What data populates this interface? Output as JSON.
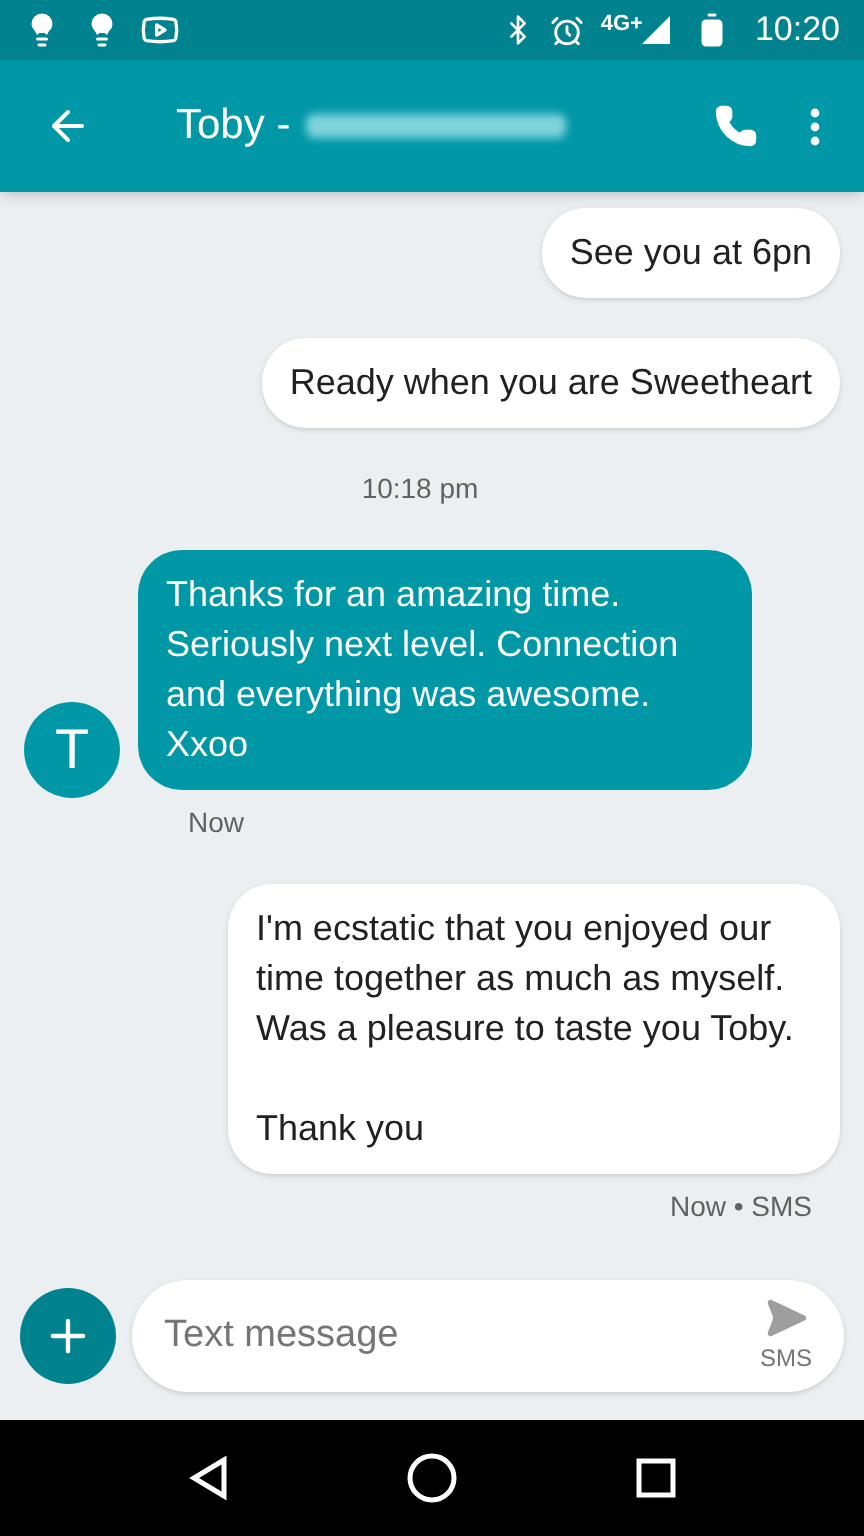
{
  "status_bar": {
    "network": "4G+",
    "time": "10:20"
  },
  "app_bar": {
    "title": "Toby -"
  },
  "messages": [
    {
      "kind": "sent",
      "text": "See you at 6pn"
    },
    {
      "kind": "sent",
      "text": "Ready when you are Sweetheart"
    },
    {
      "kind": "timestamp",
      "text": "10:18 pm"
    },
    {
      "kind": "received",
      "avatar": "T",
      "text": "Thanks for an amazing time. Seriously next level. Connection and everything was awesome. Xxoo",
      "meta": "Now"
    },
    {
      "kind": "sent",
      "text": "I'm ecstatic that you enjoyed our time together as much as myself.\nWas a pleasure to taste you Toby.\n\nThank you",
      "meta": "Now • SMS"
    }
  ],
  "composer": {
    "placeholder": "Text message",
    "send_label": "SMS"
  }
}
